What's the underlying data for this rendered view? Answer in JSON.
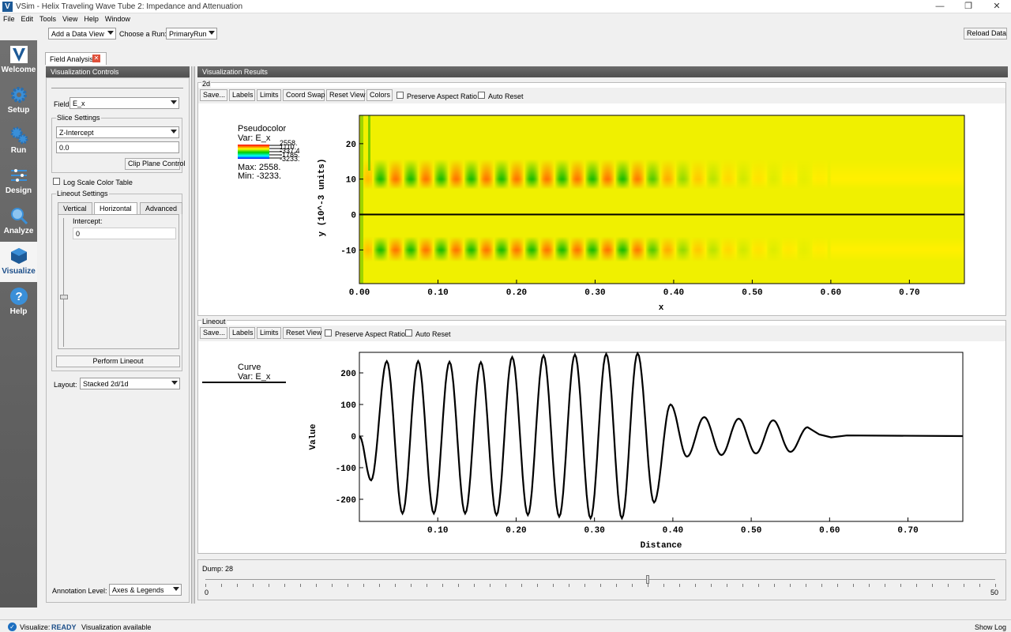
{
  "window": {
    "title": "VSim - Helix Traveling Wave Tube 2: Impedance and Attenuation",
    "minimize": "—",
    "maximize": "❐",
    "close": "✕"
  },
  "menu": [
    "File",
    "Edit",
    "Tools",
    "View",
    "Help",
    "Window"
  ],
  "sidebar": [
    {
      "label": "Welcome",
      "icon": "v-logo-icon"
    },
    {
      "label": "Setup",
      "icon": "gear-icon"
    },
    {
      "label": "Run",
      "icon": "gears-icon"
    },
    {
      "label": "Design",
      "icon": "design-icon"
    },
    {
      "label": "Analyze",
      "icon": "magnifier-icon"
    },
    {
      "label": "Visualize",
      "icon": "cube-icon"
    },
    {
      "label": "Help",
      "icon": "help-icon"
    }
  ],
  "toolbar": {
    "add_view": "Add a Data View",
    "choose_run_label": "Choose a Run:",
    "run": "PrimaryRun",
    "reload": "Reload Data"
  },
  "tab": {
    "label": "Field Analysis"
  },
  "controls": {
    "header": "Visualization Controls",
    "field_label": "Field",
    "field_value": "E_x",
    "slice_title": "Slice Settings",
    "slice_value": "Z-Intercept",
    "slice_input": "0.0",
    "clip_button": "Clip Plane Control",
    "log_scale": "Log Scale Color Table",
    "lineout_title": "Lineout Settings",
    "tabs": [
      "Vertical",
      "Horizontal",
      "Advanced"
    ],
    "intercept_label": "Intercept:",
    "intercept_value": "0",
    "perform": "Perform Lineout",
    "layout_label": "Layout:",
    "layout_value": "Stacked 2d/1d",
    "annotation_label": "Annotation Level:",
    "annotation_value": "Axes & Legends"
  },
  "results": {
    "header": "Visualization Results",
    "top": {
      "group": "2d",
      "buttons": [
        "Save...",
        "Labels",
        "Limits",
        "Coord Swap",
        "Reset View",
        "Colors"
      ],
      "preserve": "Preserve Aspect Ratio",
      "auto": "Auto Reset"
    },
    "bottom": {
      "group": "Lineout",
      "buttons": [
        "Save...",
        "Labels",
        "Limits",
        "Reset View"
      ],
      "preserve": "Preserve Aspect Ratio",
      "auto": "Auto Reset"
    }
  },
  "legend2d": {
    "title": "Pseudocolor",
    "var": "Var: E_x",
    "ticks": [
      "2558.",
      "1110.",
      "-337.4",
      "-1785.",
      "-3233."
    ],
    "max": "Max:  2558.",
    "min": "Min: -3233."
  },
  "legend1d": {
    "title": "Curve",
    "var": "Var: E_x"
  },
  "dump": {
    "label": "Dump: 28",
    "min": "0",
    "max": "50",
    "value": 28,
    "maxval": 50
  },
  "status": {
    "prefix": "Visualize:",
    "state": "READY",
    "message": "Visualization available",
    "show_log": "Show Log"
  },
  "chart_data": [
    {
      "type": "heatmap",
      "xlabel": "x",
      "ylabel": "y (10^-3 units)",
      "x_ticks": [
        "0.00",
        "0.10",
        "0.20",
        "0.30",
        "0.40",
        "0.50",
        "0.60",
        "0.70"
      ],
      "y_ticks": [
        "20",
        "10",
        "0",
        "-10"
      ],
      "xlim": [
        0,
        0.77
      ],
      "ylim": [
        -19.5,
        28
      ],
      "line_y": 0,
      "field_max": 2558,
      "field_min": -3233,
      "wavelength": 0.0385,
      "amplitude_ramp_end": 0.35,
      "decay_end": 0.6
    },
    {
      "type": "line",
      "xlabel": "Distance",
      "ylabel": "Value",
      "x_ticks": [
        "0.10",
        "0.20",
        "0.30",
        "0.40",
        "0.50",
        "0.60",
        "0.70"
      ],
      "y_ticks": [
        "200",
        "100",
        "0",
        "-100",
        "-200"
      ],
      "xlim": [
        0,
        0.77
      ],
      "ylim": [
        -270,
        265
      ],
      "series": [
        {
          "peaks_x": [
            0.015,
            0.035,
            0.055,
            0.075,
            0.095,
            0.115,
            0.135,
            0.155,
            0.175,
            0.195,
            0.215,
            0.235,
            0.255,
            0.275,
            0.295,
            0.315,
            0.335,
            0.355,
            0.376,
            0.397,
            0.418,
            0.44,
            0.462,
            0.484,
            0.506,
            0.528,
            0.55,
            0.572
          ],
          "peaks_y": [
            -140,
            237,
            -245,
            237,
            -245,
            235,
            -245,
            234,
            -250,
            250,
            -250,
            255,
            -255,
            258,
            -260,
            260,
            -260,
            262,
            -210,
            100,
            -65,
            60,
            -60,
            55,
            -55,
            50,
            -50,
            28
          ]
        }
      ]
    }
  ]
}
